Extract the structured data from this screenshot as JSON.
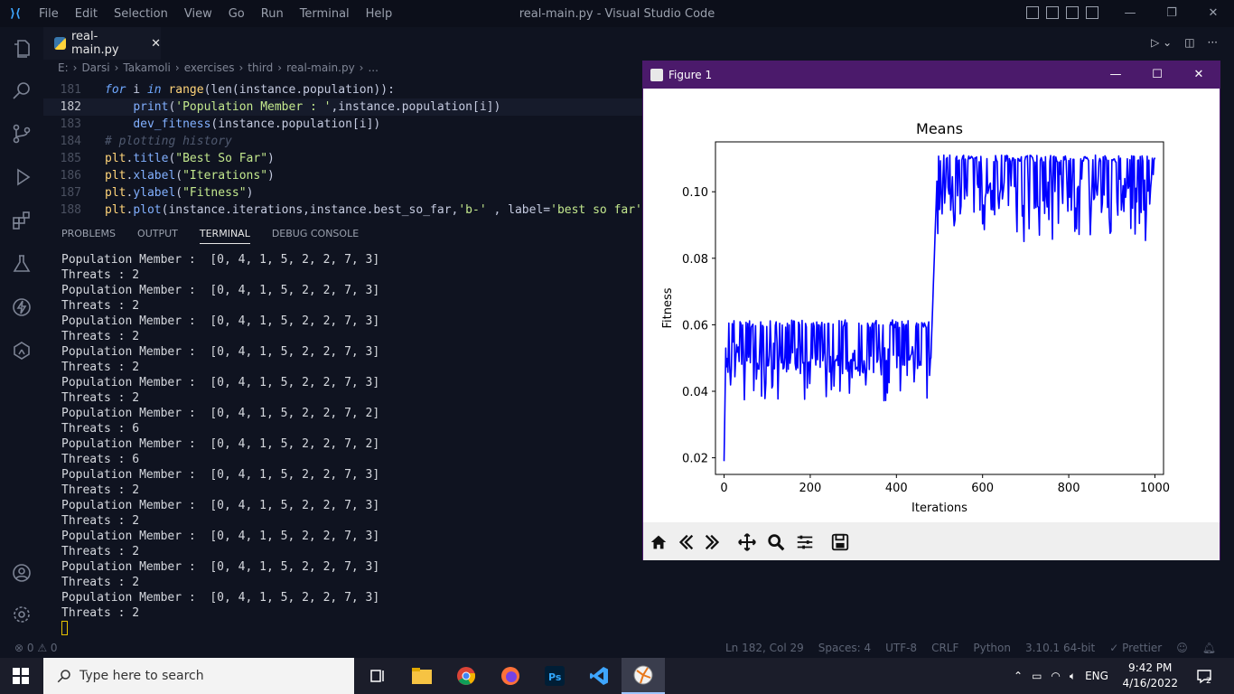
{
  "titlebar": {
    "menu": [
      "File",
      "Edit",
      "Selection",
      "View",
      "Go",
      "Run",
      "Terminal",
      "Help"
    ],
    "title": "real-main.py - Visual Studio Code"
  },
  "tab": {
    "label": "real-main.py"
  },
  "breadcrumb": [
    "E:",
    "Darsi",
    "Takamoli",
    "exercises",
    "third",
    "real-main.py",
    "..."
  ],
  "code": [
    {
      "n": "181",
      "html": "<span class='kw'>for</span> i <span class='kw'>in</span> <span class='plt'>range</span>(len(instance.population)):"
    },
    {
      "n": "182",
      "html": "    <span class='fn'>print</span>(<span class='str'>'Population Member : '</span>,instance.population[i])",
      "active": true
    },
    {
      "n": "183",
      "html": "    <span class='fn'>dev_fitness</span>(instance.population[i])"
    },
    {
      "n": "184",
      "html": "<span class='cm'># plotting history</span>"
    },
    {
      "n": "185",
      "html": "<span class='plt'>plt</span>.<span class='fn'>title</span>(<span class='str'>\"Best So Far\"</span>)"
    },
    {
      "n": "186",
      "html": "<span class='plt'>plt</span>.<span class='fn'>xlabel</span>(<span class='str'>\"Iterations\"</span>)"
    },
    {
      "n": "187",
      "html": "<span class='plt'>plt</span>.<span class='fn'>ylabel</span>(<span class='str'>\"Fitness\"</span>)"
    },
    {
      "n": "188",
      "html": "<span class='plt'>plt</span>.<span class='fn'>plot</span>(instance.iterations,instance.best_so_far,<span class='str'>'b-'</span> , label=<span class='str'>'best so far'</span>)"
    }
  ],
  "panel": {
    "tabs": [
      "PROBLEMS",
      "OUTPUT",
      "TERMINAL",
      "DEBUG CONSOLE"
    ],
    "active_tab": "TERMINAL"
  },
  "terminal": [
    "Population Member :  [0, 4, 1, 5, 2, 2, 7, 3]",
    "Threats : 2",
    "Population Member :  [0, 4, 1, 5, 2, 2, 7, 3]",
    "Threats : 2",
    "Population Member :  [0, 4, 1, 5, 2, 2, 7, 3]",
    "Threats : 2",
    "Population Member :  [0, 4, 1, 5, 2, 2, 7, 3]",
    "Threats : 2",
    "Population Member :  [0, 4, 1, 5, 2, 2, 7, 3]",
    "Threats : 2",
    "Population Member :  [0, 4, 1, 5, 2, 2, 7, 2]",
    "Threats : 6",
    "Population Member :  [0, 4, 1, 5, 2, 2, 7, 2]",
    "Threats : 6",
    "Population Member :  [0, 4, 1, 5, 2, 2, 7, 3]",
    "Threats : 2",
    "Population Member :  [0, 4, 1, 5, 2, 2, 7, 3]",
    "Threats : 2",
    "Population Member :  [0, 4, 1, 5, 2, 2, 7, 3]",
    "Threats : 2",
    "Population Member :  [0, 4, 1, 5, 2, 2, 7, 3]",
    "Threats : 2",
    "Population Member :  [0, 4, 1, 5, 2, 2, 7, 3]",
    "Threats : 2"
  ],
  "statusbar": {
    "problems": "⊗ 0 ⚠ 0",
    "items": [
      "Ln 182, Col 29",
      "Spaces: 4",
      "UTF-8",
      "CRLF",
      "Python",
      "3.10.1 64-bit",
      "✓ Prettier"
    ]
  },
  "figure": {
    "title": "Figure 1"
  },
  "chart_data": {
    "type": "line",
    "title": "Means",
    "xlabel": "Iterations",
    "ylabel": "Fitness",
    "xlim": [
      -20,
      1020
    ],
    "ylim": [
      0.015,
      0.115
    ],
    "xticks": [
      0,
      200,
      400,
      600,
      800,
      1000
    ],
    "yticks": [
      0.02,
      0.04,
      0.06,
      0.08,
      0.1
    ],
    "ytick_labels": [
      "0.02",
      "0.04",
      "0.06",
      "0.08",
      "0.10"
    ],
    "grid": false,
    "series": [
      {
        "color": "#0000ff",
        "phases": [
          {
            "x0": 0,
            "x1": 4,
            "from": 0.019,
            "to": 0.053
          },
          {
            "x0": 5,
            "x1": 479,
            "base": 0.0535,
            "low": 0.037,
            "high": 0.0615
          },
          {
            "x0": 480,
            "x1": 495,
            "from": 0.05,
            "to": 0.107
          },
          {
            "x0": 496,
            "x1": 1000,
            "base": 0.104,
            "low": 0.085,
            "high": 0.111
          }
        ]
      }
    ]
  },
  "taskbar": {
    "search_placeholder": "Type here to search",
    "lang": "ENG",
    "time": "9:42 PM",
    "date": "4/16/2022",
    "notifications": "2"
  }
}
